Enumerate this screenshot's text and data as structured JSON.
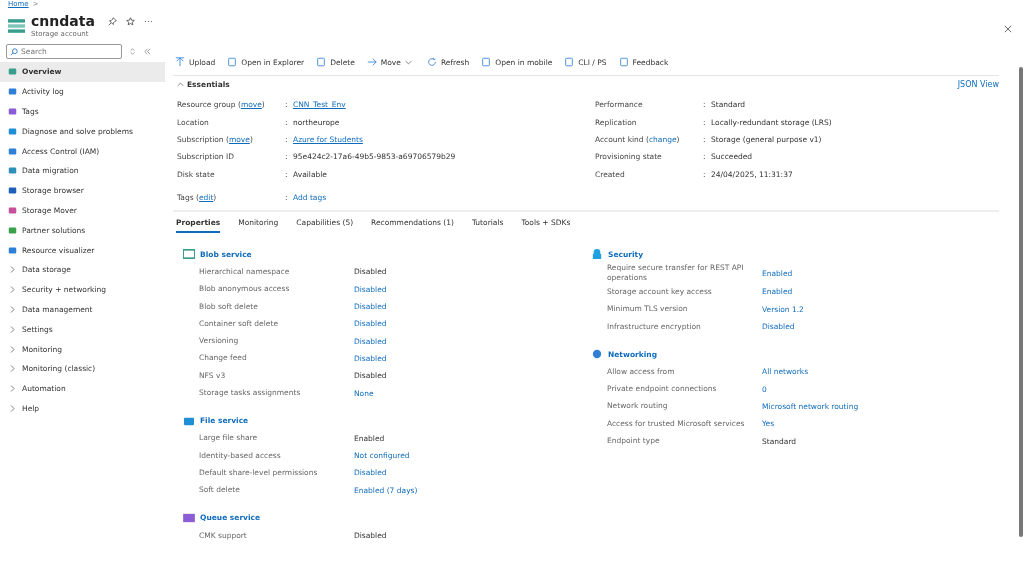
{
  "breadcrumb": [
    "Home",
    ">"
  ],
  "header": {
    "title": "cnndata",
    "subtitle": "Storage account"
  },
  "sidebar": {
    "search": {
      "placeholder": "Search"
    },
    "items": [
      {
        "label": "Overview",
        "kind": "page",
        "selected": true
      },
      {
        "label": "Activity log",
        "kind": "page",
        "selected": false
      },
      {
        "label": "Tags",
        "kind": "page",
        "selected": false
      },
      {
        "label": "Diagnose and solve problems",
        "kind": "page",
        "selected": false
      },
      {
        "label": "Access Control (IAM)",
        "kind": "page",
        "selected": false
      },
      {
        "label": "Data migration",
        "kind": "page",
        "selected": false
      },
      {
        "label": "Storage browser",
        "kind": "page",
        "selected": false
      },
      {
        "label": "Storage Mover",
        "kind": "page",
        "selected": false
      },
      {
        "label": "Partner solutions",
        "kind": "page",
        "selected": false
      },
      {
        "label": "Resource visualizer",
        "kind": "page",
        "selected": false
      },
      {
        "label": "Data storage",
        "kind": "group",
        "selected": false
      },
      {
        "label": "Security + networking",
        "kind": "group",
        "selected": false
      },
      {
        "label": "Data management",
        "kind": "group",
        "selected": false
      },
      {
        "label": "Settings",
        "kind": "group",
        "selected": false
      },
      {
        "label": "Monitoring",
        "kind": "group",
        "selected": false
      },
      {
        "label": "Monitoring (classic)",
        "kind": "group",
        "selected": false
      },
      {
        "label": "Automation",
        "kind": "group",
        "selected": false
      },
      {
        "label": "Help",
        "kind": "group",
        "selected": false
      }
    ]
  },
  "toolbar": [
    "Upload",
    "Open in Explorer",
    "Delete",
    "Move",
    "Refresh",
    "Open in mobile",
    "CLI / PS",
    "Feedback"
  ],
  "essentials": {
    "title": "Essentials",
    "json_view": "JSON View",
    "left": [
      {
        "label": "Resource group (",
        "action": "move",
        "after": ")",
        "sep": ":",
        "value": "CNN_Test_Env",
        "link": true
      },
      {
        "label": "Location",
        "sep": ":",
        "value": "northeurope",
        "link": false
      },
      {
        "label": "Subscription (",
        "action": "move",
        "after": ")",
        "sep": ":",
        "value": "Azure for Students",
        "link": true
      },
      {
        "label": "Subscription ID",
        "sep": ":",
        "value": "95e424c2-17a6-49b5-9853-a69706579b29",
        "link": false
      },
      {
        "label": "Disk state",
        "sep": ":",
        "value": "Available",
        "link": false
      }
    ],
    "right": [
      {
        "label": "Performance",
        "sep": ":",
        "value": "Standard",
        "link": false
      },
      {
        "label": "Replication",
        "sep": ":",
        "value": "Locally-redundant storage (LRS)",
        "link": false
      },
      {
        "label": "Account kind (",
        "action": "change",
        "after": ")",
        "sep": ":",
        "value": "Storage (general purpose v1)",
        "link": false
      },
      {
        "label": "Provisioning state",
        "sep": ":",
        "value": "Succeeded",
        "link": false
      },
      {
        "label": "Created",
        "sep": ":",
        "value": "24/04/2025, 11:31:37",
        "link": false
      }
    ],
    "tags": {
      "label": "Tags (",
      "action": "edit",
      "after": ")",
      "sep": ":",
      "value": "Add tags"
    }
  },
  "tabs": [
    {
      "label": "Properties",
      "selected": true
    },
    {
      "label": "Monitoring",
      "selected": false
    },
    {
      "label": "Capabilities (5)",
      "selected": false
    },
    {
      "label": "Recommendations (1)",
      "selected": false
    },
    {
      "label": "Tutorials",
      "selected": false
    },
    {
      "label": "Tools + SDKs",
      "selected": false
    }
  ],
  "columns": [
    [
      {
        "title": "Blob service",
        "kind": "blob",
        "rows": [
          {
            "label": "Hierarchical namespace",
            "value": "Disabled",
            "link": false
          },
          {
            "label": "Blob anonymous access",
            "value": "Disabled",
            "link": true
          },
          {
            "label": "Blob soft delete",
            "value": "Disabled",
            "link": true
          },
          {
            "label": "Container soft delete",
            "value": "Disabled",
            "link": true
          },
          {
            "label": "Versioning",
            "value": "Disabled",
            "link": true
          },
          {
            "label": "Change feed",
            "value": "Disabled",
            "link": true
          },
          {
            "label": "NFS v3",
            "value": "Disabled",
            "link": false
          },
          {
            "label": "Storage tasks assignments",
            "value": "None",
            "link": true
          }
        ]
      },
      {
        "title": "File service",
        "kind": "file",
        "rows": [
          {
            "label": "Large file share",
            "value": "Enabled",
            "link": false
          },
          {
            "label": "Identity-based access",
            "value": "Not configured",
            "link": true
          },
          {
            "label": "Default share-level permissions",
            "value": "Disabled",
            "link": true
          },
          {
            "label": "Soft delete",
            "value": "Enabled (7 days)",
            "link": true
          }
        ]
      },
      {
        "title": "Queue service",
        "kind": "queue",
        "rows": [
          {
            "label": "CMK support",
            "value": "Disabled",
            "link": false
          }
        ]
      }
    ],
    [
      {
        "title": "Security",
        "kind": "security",
        "rows": [
          {
            "label": "Require secure transfer for REST API operations",
            "value": "Enabled",
            "link": true
          },
          {
            "label": "Storage account key access",
            "value": "Enabled",
            "link": true
          },
          {
            "label": "Minimum TLS version",
            "value": "Version 1.2",
            "link": true
          },
          {
            "label": "Infrastructure encryption",
            "value": "Disabled",
            "link": true
          }
        ]
      },
      {
        "title": "Networking",
        "kind": "network",
        "rows": [
          {
            "label": "Allow access from",
            "value": "All networks",
            "link": true
          },
          {
            "label": "Private endpoint connections",
            "value": "0",
            "link": true
          },
          {
            "label": "Network routing",
            "value": "Microsoft network routing",
            "link": true
          },
          {
            "label": "Access for trusted Microsoft services",
            "value": "Yes",
            "link": true
          },
          {
            "label": "Endpoint type",
            "value": "Standard",
            "link": false
          }
        ]
      }
    ]
  ]
}
